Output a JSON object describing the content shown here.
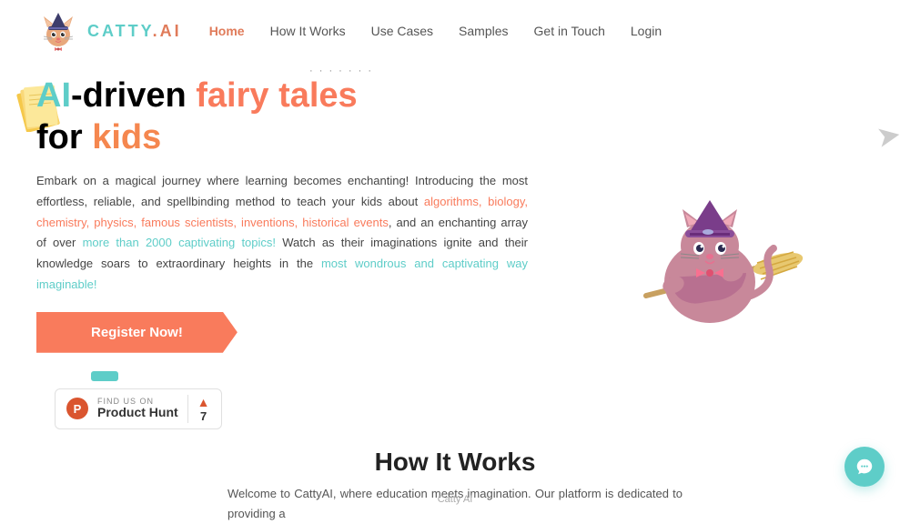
{
  "brand": {
    "logo_text_1": "CATTY",
    "logo_text_2": ".AI",
    "icon_alt": "catty-ai-logo"
  },
  "nav": {
    "items": [
      {
        "label": "Home",
        "active": true
      },
      {
        "label": "How It Works",
        "active": false
      },
      {
        "label": "Use Cases",
        "active": false
      },
      {
        "label": "Samples",
        "active": false
      },
      {
        "label": "Get in Touch",
        "active": false
      },
      {
        "label": "Login",
        "active": false
      }
    ]
  },
  "hero": {
    "title_line1_part1": "AI",
    "title_line1_part2": "-driven ",
    "title_line1_part3": "fairy tales",
    "title_line2_part1": "for ",
    "title_line2_part2": "kids",
    "description_1": "Embark on a magical journey where learning becomes enchanting! Introducing the most effortless, reliable, and spellbinding method to teach your kids about ",
    "link_topics": "algorithms, biology, chemistry, physics, famous scientists, inventions, historical events",
    "description_2": ", and an enchanting array of over ",
    "link_more": "more than 2000 captivating topics!",
    "description_3": " Watch as their imaginations ignite and their knowledge soars to extraordinary heights in the ",
    "link_wondrous": "most wondrous and captivating way imaginable!",
    "register_btn": "Register Now!",
    "ph": {
      "find_label": "FIND US ON",
      "name": "Product Hunt",
      "count": "7",
      "arrow": "▲"
    }
  },
  "how_it_works": {
    "title": "How It Works",
    "description": "Welcome to CattyAI, where education meets imagination. Our platform is dedicated to providing a"
  },
  "footer": {
    "label": "Catty AI"
  },
  "colors": {
    "teal": "#5ecdc8",
    "salmon": "#f97b5c",
    "orange": "#f5874f",
    "ph_red": "#da552f"
  }
}
